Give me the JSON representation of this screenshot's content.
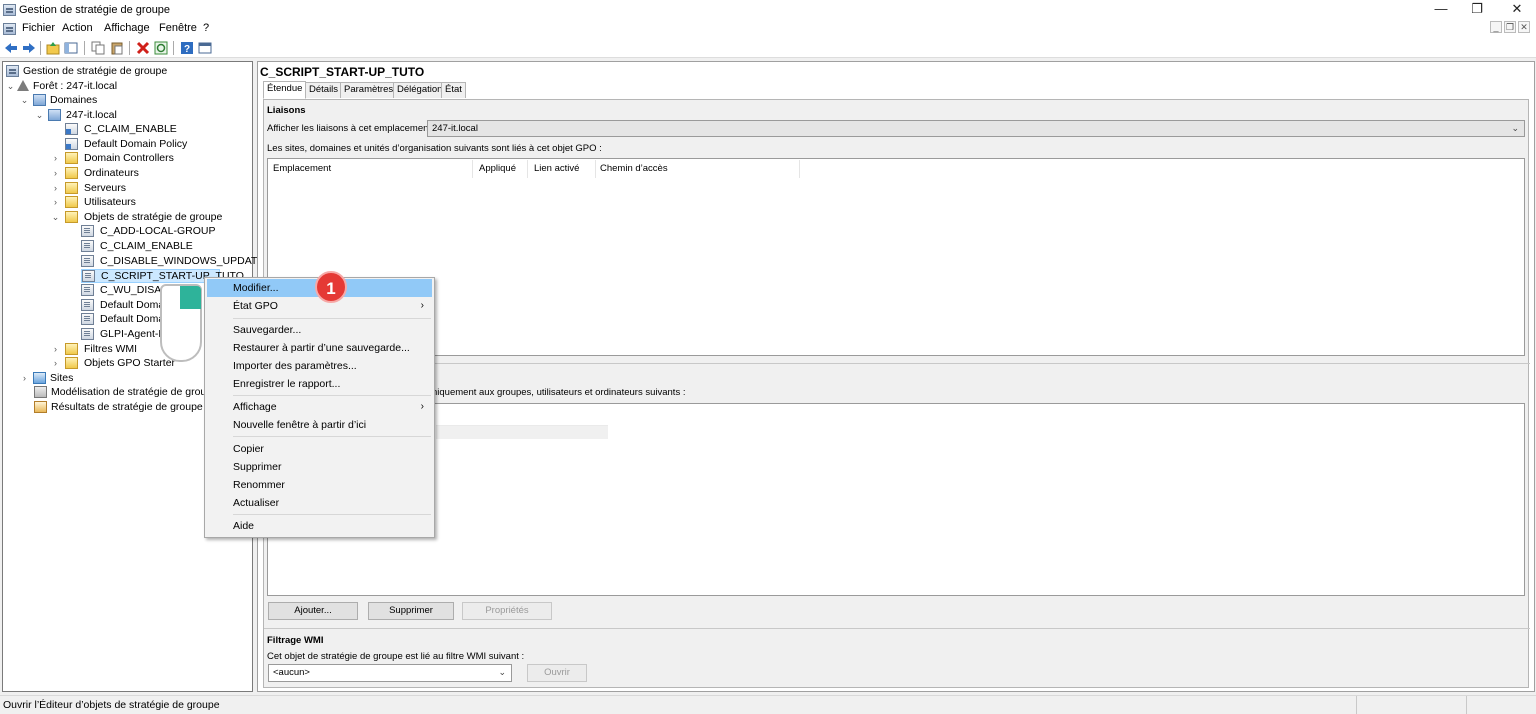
{
  "window": {
    "title": "Gestion de stratégie de groupe"
  },
  "window_controls": {
    "minimize": "—",
    "maximize": "❐",
    "close": "✕"
  },
  "mdi_controls": {
    "minimize": "_",
    "restore": "❐",
    "close": "✕"
  },
  "menubar": [
    "Fichier",
    "Action",
    "Affichage",
    "Fenêtre",
    "?"
  ],
  "toolbar_icons": [
    "back-arrow-icon",
    "forward-arrow-icon",
    "up-folder-icon",
    "show-hide-tree-icon",
    "copy-icon",
    "paste-icon",
    "delete-icon",
    "refresh-icon",
    "help-icon",
    "console-icon"
  ],
  "tree": {
    "root": "Gestion de stratégie de groupe",
    "forest": "Forêt : 247-it.local",
    "domains": "Domaines",
    "domain": "247-it.local",
    "linked": [
      "C_CLAIM_ENABLE",
      "Default Domain Policy"
    ],
    "ous": [
      "Domain Controllers",
      "Ordinateurs",
      "Serveurs",
      "Utilisateurs"
    ],
    "gpo_container": "Objets de stratégie de groupe",
    "gpos": [
      "C_ADD-LOCAL-GROUP",
      "C_CLAIM_ENABLE",
      "C_DISABLE_WINDOWS_UPDATE",
      "C_SCRIPT_START-UP_TUTO",
      "C_WU_DISABLE_USERS",
      "Default Domain Controllers Policy",
      "Default Domain Policy",
      "GLPI-Agent-M"
    ],
    "wmi": "Filtres WMI",
    "starter": "Objets GPO Starter",
    "sites": "Sites",
    "modeling": "Modélisation de stratégie de groupe",
    "results": "Résultats de stratégie de groupe"
  },
  "gpo": {
    "title": "C_SCRIPT_START-UP_TUTO"
  },
  "tabs": [
    "Étendue",
    "Détails",
    "Paramètres",
    "Délégation",
    "État"
  ],
  "links": {
    "heading": "Liaisons",
    "show_label": "Afficher les liaisons à cet emplacement :",
    "location_value": "247-it.local",
    "desc": "Les sites, domaines et unités d’organisation suivants sont liés à cet objet GPO :",
    "columns": [
      "Emplacement",
      "Appliqué",
      "Lien activé",
      "Chemin d’accès"
    ]
  },
  "security": {
    "desc_visible": "niquement aux groupes, utilisateurs et ordinateurs suivants :"
  },
  "buttons": {
    "add": "Ajouter...",
    "remove": "Supprimer",
    "properties": "Propriétés"
  },
  "wmi_filter": {
    "heading": "Filtrage WMI",
    "desc": "Cet objet de stratégie de groupe est lié au filtre WMI suivant :",
    "value": "<aucun>",
    "open": "Ouvrir"
  },
  "context_menu": {
    "edit": "Modifier...",
    "gpo_status": "État GPO",
    "backup": "Sauvegarder...",
    "restore": "Restaurer à partir d’une sauvegarde...",
    "import": "Importer des paramètres...",
    "save_report": "Enregistrer le rapport...",
    "view": "Affichage",
    "new_window": "Nouvelle fenêtre à partir d’ici",
    "copy": "Copier",
    "delete": "Supprimer",
    "rename": "Renommer",
    "refresh": "Actualiser",
    "help": "Aide",
    "submenu_arrow": "›"
  },
  "annotation": {
    "step": "1"
  },
  "status": {
    "text": "Ouvrir l’Éditeur d’objets de stratégie de groupe"
  },
  "colors": {
    "highlight": "#91c9f7",
    "selection": "#cce8ff",
    "badge": "#e53935"
  }
}
